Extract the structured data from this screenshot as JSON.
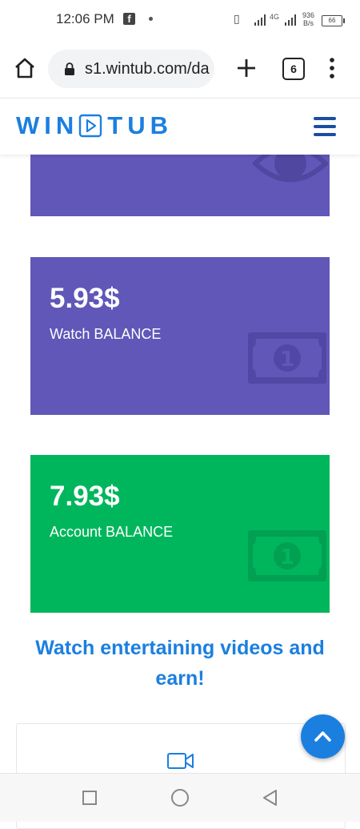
{
  "status_bar": {
    "time": "12:06 PM",
    "network": "4G",
    "speed_value": "936",
    "speed_unit": "B/s",
    "battery": "66"
  },
  "browser": {
    "url": "s1.wintub.com/da",
    "tab_count": "6"
  },
  "site": {
    "logo_left": "WIN",
    "logo_right": "TUB",
    "brand_color": "#1b7fe0"
  },
  "cards": {
    "watch": {
      "amount": "5.93$",
      "label": "Watch BALANCE",
      "color": "#6057b8"
    },
    "account": {
      "amount": "7.93$",
      "label": "Account BALANCE",
      "color": "#00b65c"
    }
  },
  "headline": "Watch entertaining videos and earn!",
  "icons": {
    "top_card": "eye-icon",
    "money": "money-bill-icon",
    "video": "video-camera-icon",
    "scroll": "chevron-up-icon"
  }
}
